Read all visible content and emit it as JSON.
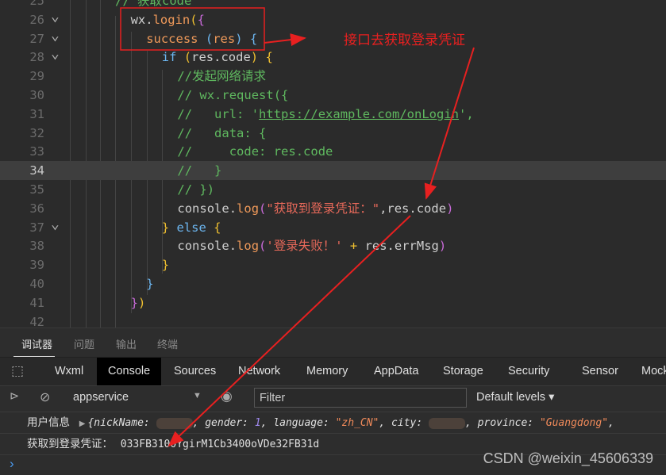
{
  "editor": {
    "current_line": 34,
    "lines": [
      {
        "n": 25,
        "fold": false,
        "indent": 0,
        "tokens": [
          {
            "t": "// 获取code",
            "c": "cm"
          }
        ]
      },
      {
        "n": 26,
        "fold": true,
        "indent": 1,
        "tokens": [
          {
            "t": "wx.",
            "c": "id"
          },
          {
            "t": "login",
            "c": "fn"
          },
          {
            "t": "(",
            "c": "p1"
          },
          {
            "t": "{",
            "c": "p2"
          }
        ]
      },
      {
        "n": 27,
        "fold": true,
        "indent": 2,
        "tokens": [
          {
            "t": "success ",
            "c": "fn"
          },
          {
            "t": "(",
            "c": "p3"
          },
          {
            "t": "res",
            "c": "fn"
          },
          {
            "t": ") ",
            "c": "p3"
          },
          {
            "t": "{",
            "c": "p3"
          }
        ]
      },
      {
        "n": 28,
        "fold": true,
        "indent": 3,
        "tokens": [
          {
            "t": "if ",
            "c": "kw"
          },
          {
            "t": "(",
            "c": "p1"
          },
          {
            "t": "res.code",
            "c": "id"
          },
          {
            "t": ") ",
            "c": "p1"
          },
          {
            "t": "{",
            "c": "p1"
          }
        ]
      },
      {
        "n": 29,
        "fold": false,
        "indent": 4,
        "tokens": [
          {
            "t": "//发起网络请求",
            "c": "cm"
          }
        ]
      },
      {
        "n": 30,
        "fold": false,
        "indent": 4,
        "tokens": [
          {
            "t": "// wx.request({",
            "c": "cm"
          }
        ]
      },
      {
        "n": 31,
        "fold": false,
        "indent": 4,
        "tokens": [
          {
            "t": "//   url: '",
            "c": "cm"
          },
          {
            "t": "https://example.com/onLogin",
            "c": "url"
          },
          {
            "t": "',",
            "c": "cm"
          }
        ]
      },
      {
        "n": 32,
        "fold": false,
        "indent": 4,
        "tokens": [
          {
            "t": "//   data: {",
            "c": "cm"
          }
        ]
      },
      {
        "n": 33,
        "fold": false,
        "indent": 4,
        "tokens": [
          {
            "t": "//     code: res.code",
            "c": "cm"
          }
        ]
      },
      {
        "n": 34,
        "fold": false,
        "indent": 4,
        "tokens": [
          {
            "t": "//   }",
            "c": "cm"
          }
        ]
      },
      {
        "n": 35,
        "fold": false,
        "indent": 4,
        "tokens": [
          {
            "t": "// })",
            "c": "cm"
          }
        ]
      },
      {
        "n": 36,
        "fold": false,
        "indent": 4,
        "tokens": [
          {
            "t": "console.",
            "c": "id"
          },
          {
            "t": "log",
            "c": "fn"
          },
          {
            "t": "(",
            "c": "p2"
          },
          {
            "t": "\"获取到登录凭证：\"",
            "c": "str"
          },
          {
            "t": ",res.code",
            "c": "id"
          },
          {
            "t": ")",
            "c": "p2"
          }
        ]
      },
      {
        "n": 37,
        "fold": true,
        "indent": 3,
        "tokens": [
          {
            "t": "} ",
            "c": "p1"
          },
          {
            "t": "else ",
            "c": "kw"
          },
          {
            "t": "{",
            "c": "p1"
          }
        ]
      },
      {
        "n": 38,
        "fold": false,
        "indent": 4,
        "tokens": [
          {
            "t": "console.",
            "c": "id"
          },
          {
            "t": "log",
            "c": "fn"
          },
          {
            "t": "(",
            "c": "p2"
          },
          {
            "t": "'登录失败！'",
            "c": "str"
          },
          {
            "t": " + ",
            "c": "p1"
          },
          {
            "t": "res.errMsg",
            "c": "id"
          },
          {
            "t": ")",
            "c": "p2"
          }
        ]
      },
      {
        "n": 39,
        "fold": false,
        "indent": 3,
        "tokens": [
          {
            "t": "}",
            "c": "p1"
          }
        ]
      },
      {
        "n": 40,
        "fold": false,
        "indent": 2,
        "tokens": [
          {
            "t": "}",
            "c": "p3"
          }
        ]
      },
      {
        "n": 41,
        "fold": false,
        "indent": 1,
        "tokens": [
          {
            "t": "}",
            "c": "p2"
          },
          {
            "t": ")",
            "c": "p1"
          }
        ]
      },
      {
        "n": 42,
        "fold": false,
        "indent": 0,
        "tokens": []
      }
    ]
  },
  "annotation": {
    "note": "接口去获取登录凭证",
    "color": "#e82020"
  },
  "panel": {
    "tabs": [
      "调试器",
      "问题",
      "输出",
      "终端"
    ],
    "devtools_tabs": [
      "Wxml",
      "Console",
      "Sources",
      "Network",
      "Memory",
      "AppData",
      "Storage",
      "Security",
      "Sensor",
      "Mock"
    ],
    "active_devtools_tab": "Console",
    "context": "appservice",
    "filter_placeholder": "Filter",
    "levels": "Default levels ▾"
  },
  "console": {
    "row1": {
      "label": "用户信息",
      "k1": "{nickName: ",
      "k2": ", gender: ",
      "v2": "1",
      "k3": ", language: ",
      "v3": "\"zh_CN\"",
      "k4": ", city: ",
      "k5": ", province: ",
      "v5": "\"Guangdong\"",
      "end": ","
    },
    "row2": {
      "label": "获取到登录凭证：",
      "value": "033FB3100YgirM1Cb3400oVDe32FB31d"
    },
    "prompt": "›"
  },
  "watermark": "CSDN @weixin_45606339"
}
